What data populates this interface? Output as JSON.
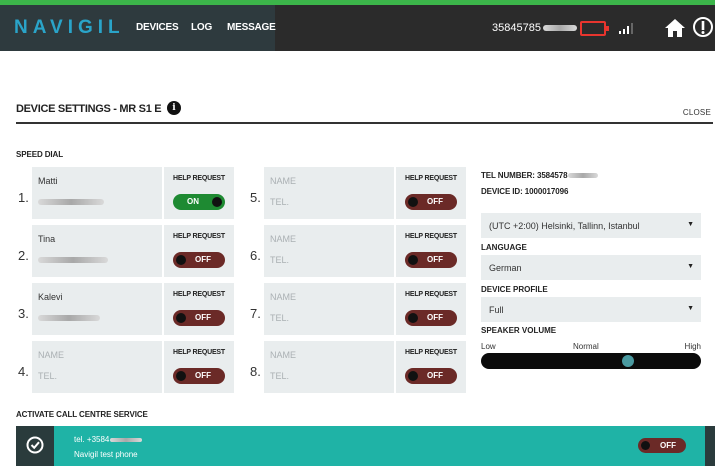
{
  "app": {
    "brand": "NAVIGIL",
    "nav": [
      {
        "label": "DEVICES"
      },
      {
        "label": "LOG"
      },
      {
        "label": "MESSAGE"
      }
    ],
    "phone": "35845785",
    "battery_color": "#e8352e"
  },
  "page": {
    "title": "DEVICE SETTINGS - MR S1 E",
    "close_label": "CLOSE",
    "info_glyph": "i"
  },
  "speed_dial": {
    "label": "SPEED DIAL",
    "help_label": "HELP REQUEST",
    "slots": [
      {
        "num": "1.",
        "name": "Matti",
        "tel": "",
        "tel_hidden": true,
        "help": "ON"
      },
      {
        "num": "2.",
        "name": "Tina",
        "tel": "",
        "tel_hidden": true,
        "help": "OFF"
      },
      {
        "num": "3.",
        "name": "Kalevi",
        "tel": "",
        "tel_hidden": true,
        "help": "OFF"
      },
      {
        "num": "4.",
        "name": "NAME",
        "tel": "TEL.",
        "tel_hidden": false,
        "help": "OFF"
      },
      {
        "num": "5.",
        "name": "NAME",
        "tel": "TEL.",
        "tel_hidden": false,
        "help": "OFF"
      },
      {
        "num": "6.",
        "name": "NAME",
        "tel": "TEL.",
        "tel_hidden": false,
        "help": "OFF"
      },
      {
        "num": "7.",
        "name": "NAME",
        "tel": "TEL.",
        "tel_hidden": false,
        "help": "OFF"
      },
      {
        "num": "8.",
        "name": "NAME",
        "tel": "TEL.",
        "tel_hidden": false,
        "help": "OFF"
      }
    ]
  },
  "device": {
    "tel_number": "TEL NUMBER: 3584578",
    "device_id": "DEVICE ID: 1000017096",
    "timezone": "(UTC +2:00) Helsinki, Tallinn, Istanbul",
    "language_label": "LANGUAGE",
    "language": "German",
    "profile_label": "DEVICE PROFILE",
    "profile": "Full",
    "volume_label": "SPEAKER VOLUME",
    "volume_low": "Low",
    "volume_normal": "Normal",
    "volume_high": "High",
    "volume_level": 0.68,
    "caret": "▼"
  },
  "call_centre": {
    "label": "ACTIVATE CALL CENTRE SERVICE",
    "tel": "tel. +3584",
    "name": "Navigil test phone",
    "state": "OFF"
  },
  "colors": {
    "accent_green": "#3cb54a",
    "brand_blue": "#2aa4c9",
    "toggle_on": "#1e8a32",
    "toggle_off": "#6b2a27",
    "teal": "#1fb3a6"
  },
  "icons": {
    "home": "home-icon",
    "info": "info-icon",
    "signal": "signal-icon",
    "battery": "battery-icon",
    "check": "check-circle-icon"
  }
}
